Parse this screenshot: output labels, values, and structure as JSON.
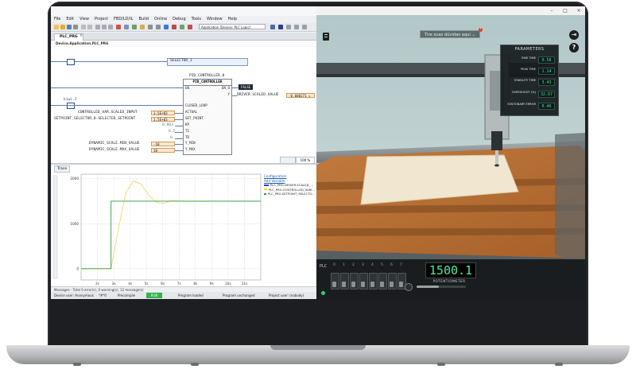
{
  "ide": {
    "menu": [
      "File",
      "Edit",
      "View",
      "Project",
      "FBD/LD/IL",
      "Build",
      "Online",
      "Debug",
      "Tools",
      "Window",
      "Help"
    ],
    "app_combo": "Application [Device: PLC Logic]",
    "tab_label": "PLC_PRG",
    "doc_path": "Device.Application.PLC_PRG",
    "cfc": {
      "selector_label": "SELECTOR_1",
      "pid_instance": "PID_CONTROLLER_0",
      "pid_type": "PID_CONTROLLER",
      "pin_en": "EN",
      "pin_eno": "EN_O",
      "pin_y": "Y",
      "false_box": "FALSE",
      "driver_var": "DRIVER.SCALED_VALUE",
      "driver_val": "-0.000271 ▸",
      "kiwi_label": "kiwi.2",
      "in_scaled_label": "CONTROLLED_VAR.SCALED_INPUT",
      "in_scaled_val": "1.5E+03",
      "in_setpoint_label": "SETPOINT_SELECTOR_0.SELECTED_SETPOINT",
      "in_setpoint_val": "1.5E+03",
      "kp_val": "0.003",
      "ti_val": "0.5",
      "td_val": "0",
      "min_label": "DYNAMIC_SCALE.MIN_VALUE",
      "min_val": "-10",
      "max_label": "DYNAMIC_SCALE.MAX_VALUE",
      "max_val": "10",
      "pin_closed_loop": "CLOSED_LOOP",
      "pin_actual": "ACTUAL",
      "pin_set_point": "SET_POINT",
      "pin_kp": "KP",
      "pin_ti": "TI",
      "pin_td": "TD",
      "pin_y_min": "Y_MIN",
      "pin_y_max": "Y_MAX",
      "zoom": "100 %"
    },
    "trace": {
      "tab_label": "Trace",
      "config_link": "Configuration",
      "add_var_link": "Add Variable",
      "legend": [
        {
          "name": "PLC_PRG.DRIVER.SCALED_...",
          "color": "#2a3fbf"
        },
        {
          "name": "PLC_PRG.CONTROLLED_VARI...",
          "color": "#e6d23b"
        },
        {
          "name": "PLC_PRG.SETPOINT_SELECTO...",
          "color": "#2e9a3e"
        }
      ]
    },
    "messages": "Messages - Total 0 error(s), 0 warning(s), 12 message(s)",
    "status": {
      "user": "Device user: Anonymous",
      "build": "*#*0",
      "precompile": "Precompile",
      "run": "RUN",
      "loaded": "Program loaded",
      "unchanged": "Program unchanged",
      "project_user": "Project user: (nobody)"
    }
  },
  "chart_data": {
    "type": "line",
    "x": [
      0,
      1,
      2,
      2.5,
      3,
      3.5,
      4,
      4.5,
      5,
      5.5,
      6,
      7,
      8,
      9,
      10,
      11,
      12
    ],
    "xtick_labels": [
      "2s",
      "3s",
      "4s",
      "5s",
      "6s",
      "7s",
      "8s",
      "9s",
      "10s",
      "11s"
    ],
    "ytick_labels": [
      "2000",
      "1000",
      "0"
    ],
    "ylim": [
      -250,
      2100
    ],
    "series": [
      {
        "name": "PLC_PRG.CONTROLLED_VARI...",
        "values": [
          0,
          0,
          0,
          900,
          1700,
          1950,
          1880,
          1640,
          1480,
          1450,
          1510,
          1500,
          1495,
          1500,
          1500,
          1500,
          1500
        ]
      },
      {
        "name": "PLC_PRG.SETPOINT_SELECTO...",
        "values": [
          0,
          0,
          1500,
          1500,
          1500,
          1500,
          1500,
          1500,
          1500,
          1500,
          1500,
          1500,
          1500,
          1500,
          1500,
          1500,
          1500
        ]
      }
    ]
  },
  "sim": {
    "help_dropdown": "Tire suas dúvidas aqui ⌄",
    "notif_count": "1",
    "params_title": "PARAMETERS",
    "params": [
      {
        "label": "RISE TIME",
        "value": "0.58"
      },
      {
        "label": "PEAK TIME",
        "value": "1.14"
      },
      {
        "label": "STABILITY TIME",
        "value": "3.43"
      },
      {
        "label": "OVERSHOOT (%)",
        "value": "32.67"
      },
      {
        "label": "STATIONARY ERROR",
        "value": "0.46"
      }
    ],
    "plc_label": "PLC",
    "switch_numbers": [
      "0",
      "1",
      "2",
      "3",
      "4",
      "5",
      "6",
      "7"
    ],
    "pot_value": "1500.1",
    "pot_label": "POTENTIOMETER",
    "pot_fraction": 0.45,
    "help_icon": "?",
    "colors": {
      "lcd": "#44f0a0",
      "accent_green": "#35b34a"
    }
  }
}
